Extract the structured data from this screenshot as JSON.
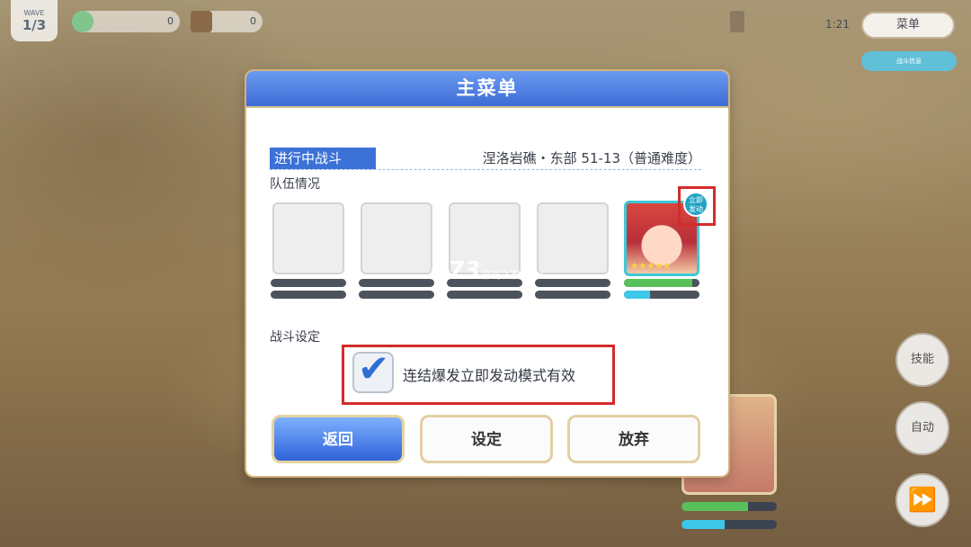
{
  "hud": {
    "wave_caption": "WAVE",
    "wave_value": "1/3",
    "gem_count": "0",
    "chest_count": "0",
    "timer": "1:21",
    "menu_label": "菜单",
    "battle_info_label": "战斗信息"
  },
  "controls": {
    "skill_label": "技能",
    "auto_label": "自动",
    "speed_icon": "fast-forward-icon"
  },
  "dialog": {
    "title": "主菜单",
    "in_battle_label": "进行中战斗",
    "stage_name": "涅洛岩礁・东部 51-13（普通难度）",
    "team_label": "队伍情况",
    "ready_badge": "立即\n发动",
    "battle_settings_label": "战斗设定",
    "setting_option": "连结爆发立即发动模式有效",
    "setting_checked": true,
    "hp_fraction": 0.9,
    "tp_fraction": 0.35,
    "buttons": {
      "back": "返回",
      "settings": "设定",
      "give_up": "放弃"
    }
  },
  "watermark": {
    "logo": "K73",
    "text": "游戏之家",
    "domain": ".com"
  },
  "colors": {
    "accent_blue": "#3c72d8",
    "highlight_red": "#d42c2c",
    "hp_green": "#58c05a",
    "tp_cyan": "#3cc8e8"
  }
}
